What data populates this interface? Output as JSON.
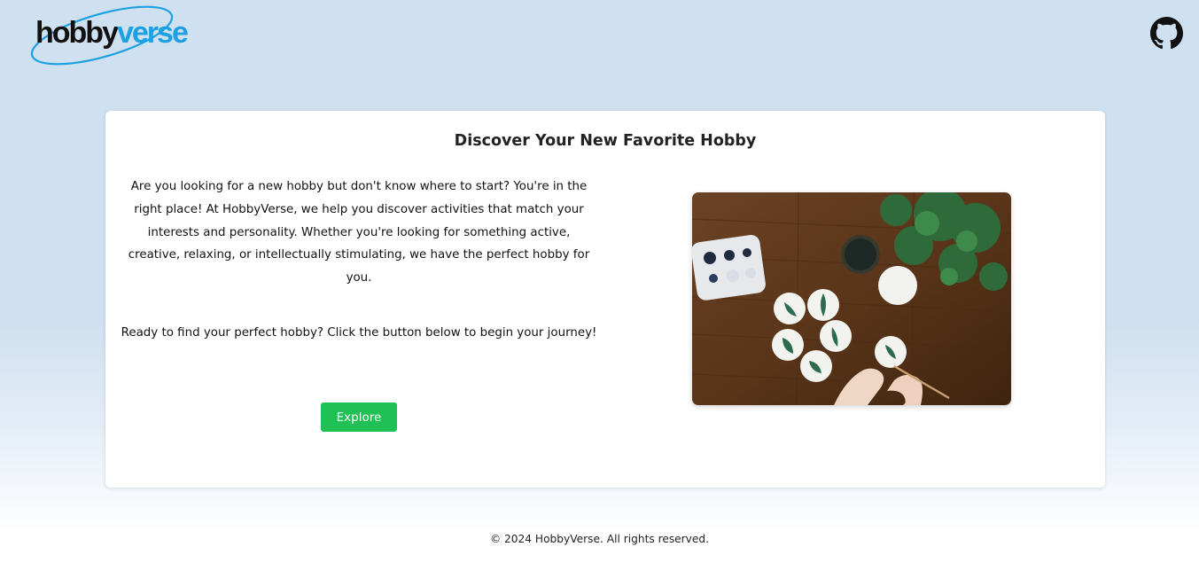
{
  "header": {
    "logo_part1": "hobby",
    "logo_part2": "verse",
    "github_icon": "github-icon"
  },
  "hero": {
    "title": "Discover Your New Favorite Hobby",
    "intro": "Are you looking for a new hobby but don't know where to start? You're in the right place! At HobbyVerse, we help you discover activities that match your interests and personality. Whether you're looking for something active, creative, relaxing, or intellectually stimulating, we have the perfect hobby for you.",
    "cta_text": "Ready to find your perfect hobby? Click the button below to begin your journey!",
    "explore_label": "Explore"
  },
  "footer": {
    "copyright": "© 2024 HobbyVerse. All rights reserved."
  },
  "colors": {
    "background_top": "#cfe0f0",
    "accent_green": "#1fc054",
    "logo_blue": "#1da1e2"
  }
}
